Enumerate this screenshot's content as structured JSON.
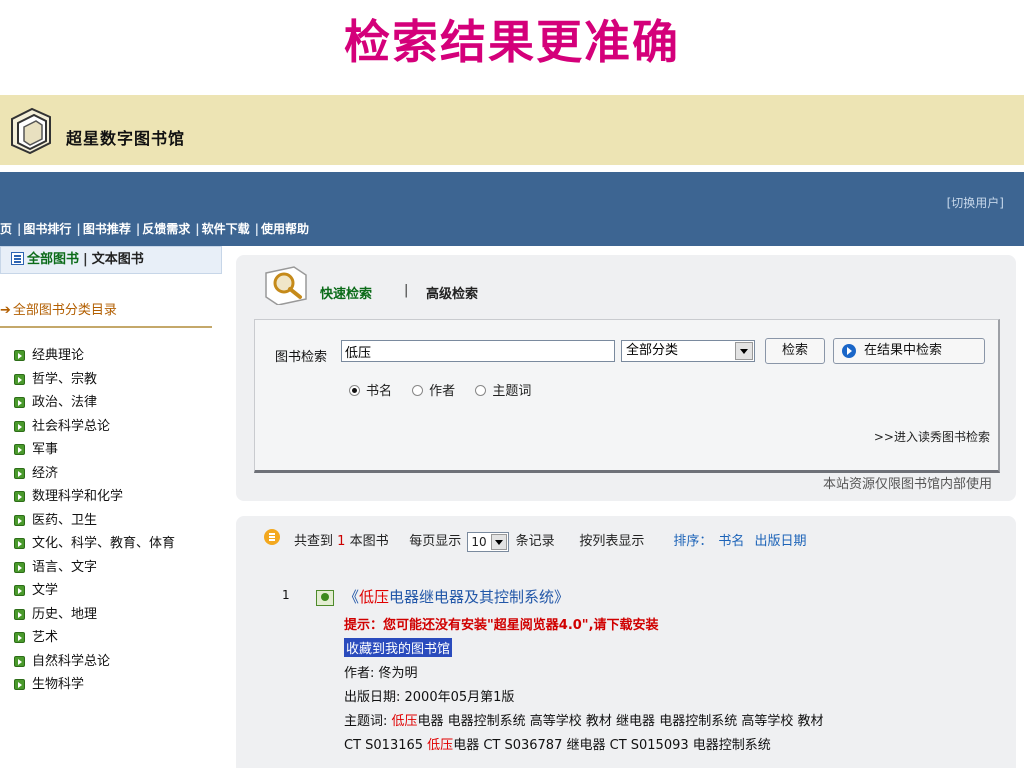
{
  "slide_title": "检索结果更准确",
  "header": {
    "logo_text": "超星数字图书馆",
    "switch_user": "[切换用户]",
    "nav": [
      "页",
      "图书排行",
      "图书推荐",
      "反馈需求",
      "软件下载",
      "使用帮助"
    ]
  },
  "sidebar": {
    "tab_all": "全部图书",
    "tab_sep": "|",
    "tab_text": "文本图书",
    "category_header": "全部图书分类目录",
    "categories": [
      "经典理论",
      "哲学、宗教",
      "政治、法律",
      "社会科学总论",
      "军事",
      "经济",
      "数理科学和化学",
      "医药、卫生",
      "文化、科学、教育、体育",
      "语言、文字",
      "文学",
      "历史、地理",
      "艺术",
      "自然科学总论",
      "生物科学"
    ]
  },
  "search": {
    "tab_quick": "快速检索",
    "tab_sep": "|",
    "tab_advanced": "高级检索",
    "label": "图书检索",
    "query": "低压",
    "category_selected": "全部分类",
    "search_button": "检索",
    "refine_button": "在结果中检索",
    "radio_options": [
      "书名",
      "作者",
      "主题词"
    ],
    "radio_selected": "书名",
    "duxiu_link": ">>进入读秀图书检索",
    "notice": "本站资源仅限图书馆内部使用"
  },
  "results": {
    "found_prefix": "共查到",
    "found_count": "1",
    "found_suffix": "本图书",
    "perpage_label": "每页显示",
    "perpage_value": "10",
    "perpage_suffix": "条记录",
    "list_view": "按列表显示",
    "sort_label": "排序：",
    "sort_options": [
      "书名",
      "出版日期"
    ],
    "items": [
      {
        "number": "1",
        "title_open": "《",
        "title_highlight": "低压",
        "title_rest": "电器继电器及其控制系统》",
        "hint": "提示：您可能还没有安装\"超星阅览器4.0\",请下载安装",
        "favorite": "收藏到我的图书馆",
        "author": "作者: 佟为明",
        "pub_date": "出版日期: 2000年05月第1版",
        "subject_label": "主题词: ",
        "subject_highlight": "低压",
        "subject_rest": "电器 电器控制系统 高等学校 教材 继电器 电器控制系统 高等学校 教材",
        "classification_prefix": "CT S013165 ",
        "classification_highlight": "低压",
        "classification_rest": "电器 CT S036787 继电器 CT S015093 电器控制系统"
      }
    ]
  },
  "colors": {
    "title_magenta": "#d4007a",
    "nav_blue": "#3d6592",
    "logo_bar": "#ede4b4",
    "highlight_red": "#e00000"
  }
}
